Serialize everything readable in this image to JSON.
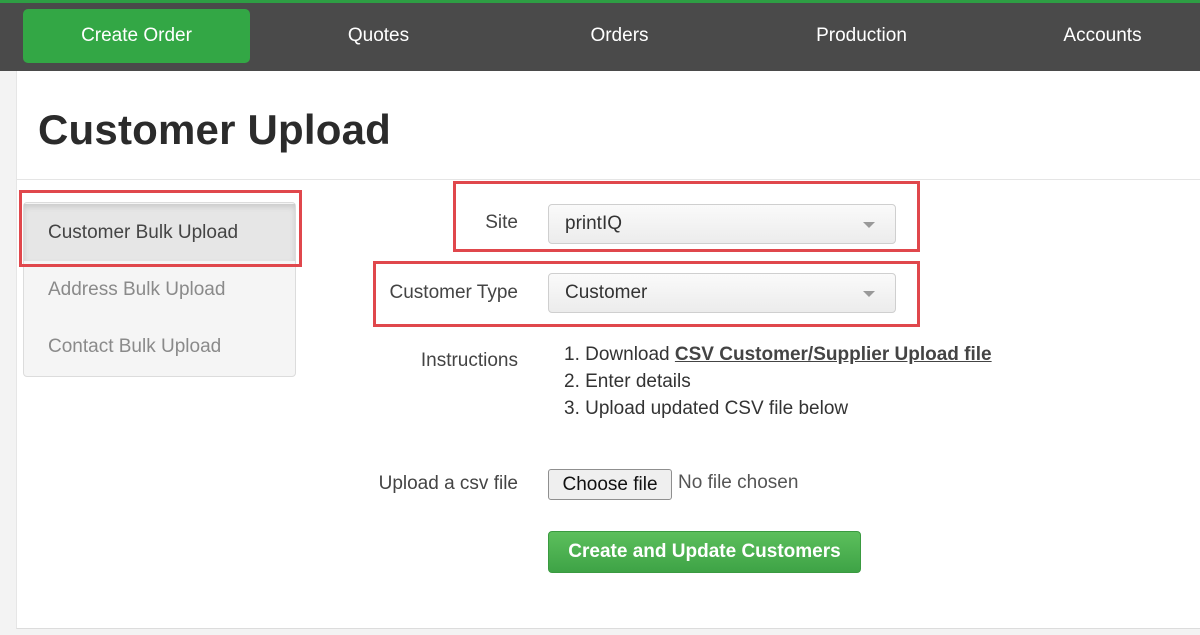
{
  "nav": {
    "items": [
      {
        "label": "Create Order",
        "active": true
      },
      {
        "label": "Quotes"
      },
      {
        "label": "Orders"
      },
      {
        "label": "Production"
      },
      {
        "label": "Accounts"
      }
    ]
  },
  "page": {
    "title": "Customer Upload"
  },
  "sidebar": {
    "items": [
      {
        "label": "Customer Bulk Upload",
        "active": true
      },
      {
        "label": "Address Bulk Upload"
      },
      {
        "label": "Contact Bulk Upload"
      }
    ]
  },
  "form": {
    "site": {
      "label": "Site",
      "value": "printIQ"
    },
    "customer_type": {
      "label": "Customer Type",
      "value": "Customer"
    },
    "instructions": {
      "label": "Instructions",
      "step1_prefix": "1. Download ",
      "step1_link": "CSV Customer/Supplier Upload file",
      "step2": "2. Enter details",
      "step3": "3. Upload updated CSV file below"
    },
    "upload": {
      "label": "Upload a csv file",
      "button": "Choose file",
      "status": "No file chosen"
    },
    "submit_label": "Create and Update Customers"
  },
  "colors": {
    "nav_bg": "#4a4a4a",
    "accent_green": "#33a745",
    "highlight_red": "#e0474c"
  }
}
